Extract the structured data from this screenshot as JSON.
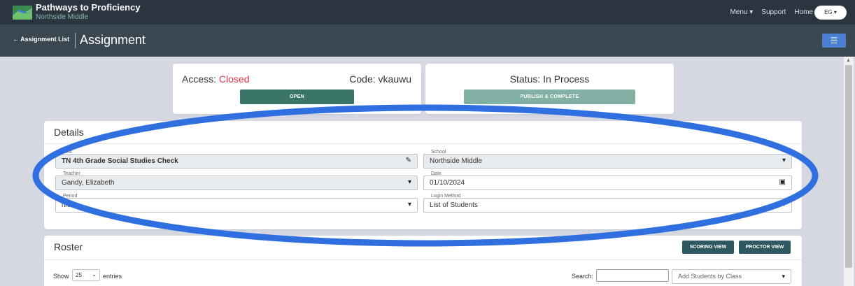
{
  "header": {
    "brand_title": "Pathways to Proficiency",
    "brand_subtitle": "Northside Middle",
    "nav": {
      "menu": "Menu ▾",
      "support": "Support",
      "home": "Home"
    },
    "user_initials": "EG ▾"
  },
  "subheader": {
    "back_label": "← Assignment List",
    "page_title": "Assignment",
    "menu_icon": "☰"
  },
  "access": {
    "label": "Access: ",
    "value": "Closed",
    "code": "Code: vkauwu",
    "open_button": "OPEN"
  },
  "status": {
    "label": "Status: In Process",
    "publish_button": "PUBLISH & COMPLETE"
  },
  "details": {
    "title": "Details",
    "test": {
      "label": "Test",
      "value": "TN 4th Grade Social Studies Check"
    },
    "school": {
      "label": "School",
      "value": "Northside Middle"
    },
    "teacher": {
      "label": "Teacher",
      "value": "Gandy, Elizabeth"
    },
    "date": {
      "label": "Date",
      "value": "01/10/2024"
    },
    "period": {
      "label": "Period",
      "value": "n/a"
    },
    "login_method": {
      "label": "Login Method",
      "value": "List of Students"
    }
  },
  "roster": {
    "title": "Roster",
    "scoring_button": "SCORING VIEW",
    "proctor_button": "PROCTOR VIEW",
    "show_label": "Show",
    "entries_value": "25",
    "entries_label": "entries",
    "search_label": "Search:",
    "add_students_placeholder": "Add Students by Class"
  },
  "colors": {
    "topbar": "#2b3540",
    "subbar": "#3a4650",
    "closed_red": "#e2354a",
    "open_green": "#3a7567",
    "publish_green": "#82b0a4",
    "dark_teal": "#2e5960",
    "menu_blue": "#4a7fd1",
    "annotation_blue": "#2f6fe0"
  }
}
